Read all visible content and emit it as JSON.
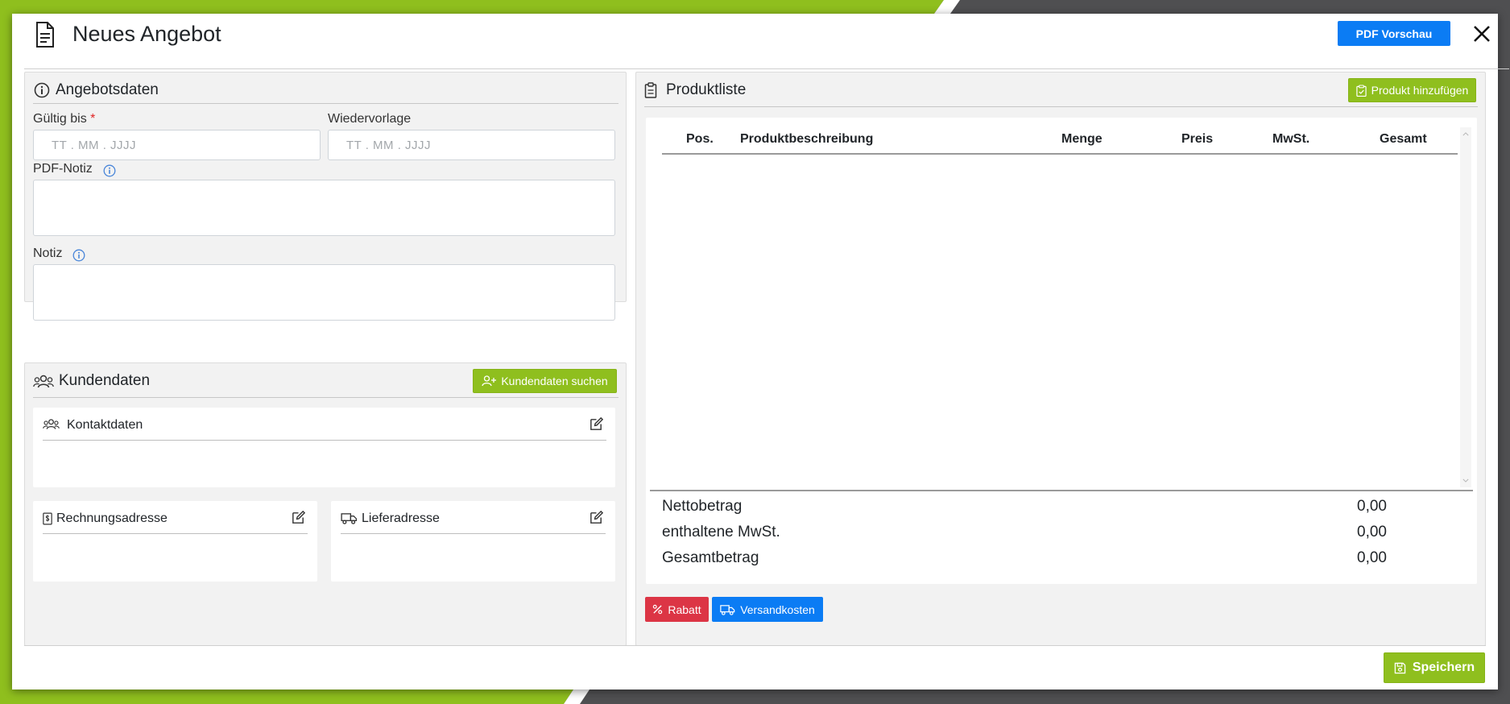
{
  "modal": {
    "title": "Neues Angebot",
    "pdf_preview_label": "PDF Vorschau",
    "icons": {
      "title": "document-icon",
      "close": "close-icon"
    }
  },
  "offer": {
    "title": "Angebotsdaten",
    "valid_until_label": "Gültig bis",
    "required_mark": "*",
    "valid_until_placeholder": "TT . MM . JJJJ",
    "resubmission_label": "Wiedervorlage",
    "resubmission_placeholder": "TT . MM . JJJJ",
    "pdf_note_label": "PDF-Notiz",
    "pdf_note_value": "",
    "note_label": "Notiz",
    "note_value": ""
  },
  "customer": {
    "title": "Kundendaten",
    "search_label": "Kundendaten suchen",
    "contact_title": "Kontaktdaten",
    "billing_title": "Rechnungsadresse",
    "shipping_title": "Lieferadresse"
  },
  "products": {
    "title": "Produktliste",
    "add_label": "Produkt hinzufügen",
    "columns": [
      "Pos.",
      "Produktbeschreibung",
      "Menge",
      "Preis",
      "MwSt.",
      "Gesamt"
    ],
    "rows": [],
    "totals": [
      {
        "label": "Nettobetrag",
        "value": "0,00"
      },
      {
        "label": "enthaltene MwSt.",
        "value": "0,00"
      },
      {
        "label": "Gesamtbetrag",
        "value": "0,00"
      }
    ],
    "discount_label": "Rabatt",
    "shipping_cost_label": "Versandkosten"
  },
  "footer": {
    "save_label": "Speichern"
  },
  "colors": {
    "green": "#8fbf1e",
    "blue": "#0b7cf4",
    "red": "#dc3545",
    "background": "#4f4f51"
  }
}
